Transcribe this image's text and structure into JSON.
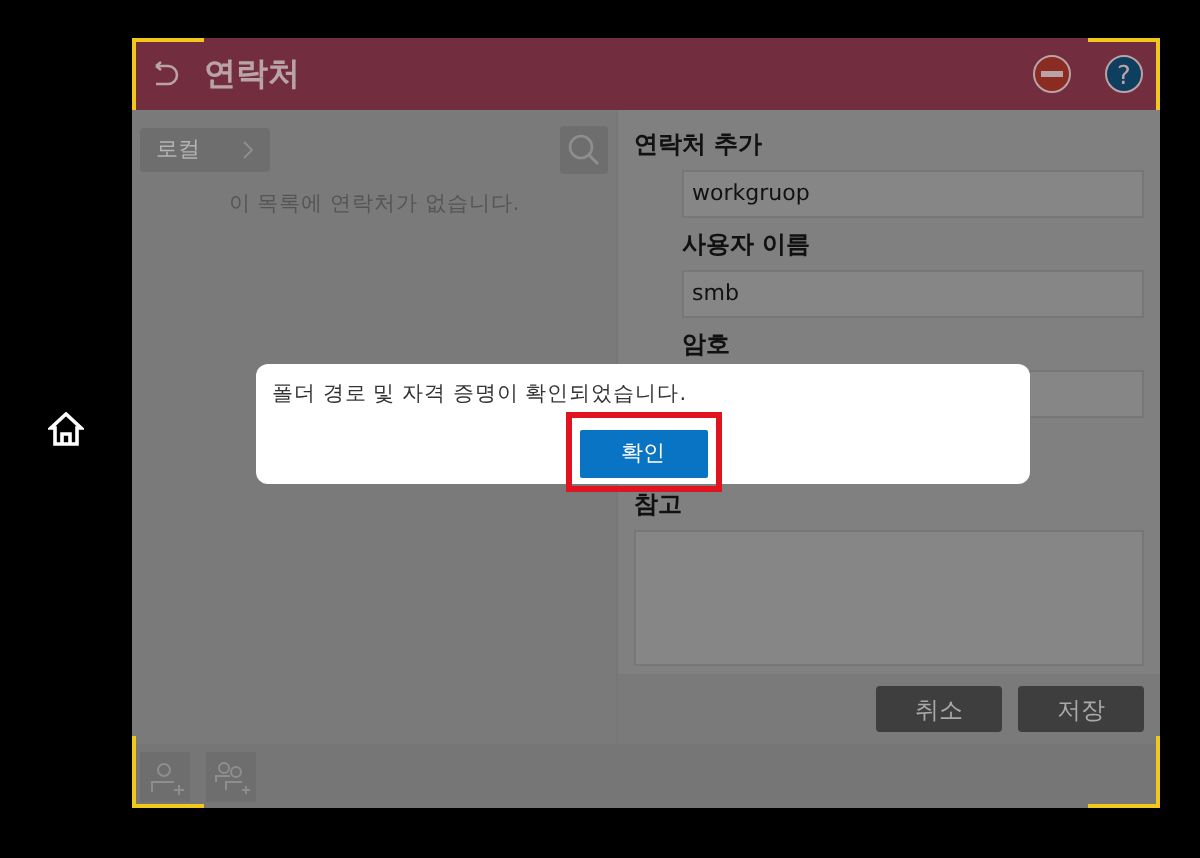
{
  "header": {
    "title": "연락처",
    "help_symbol": "?"
  },
  "contact_list": {
    "source_button": "로컬",
    "empty_message": "이 목록에 연락처가 없습니다."
  },
  "form": {
    "heading": "연락처 추가",
    "fields": [
      {
        "kind": "input",
        "value": "workgruop"
      },
      {
        "kind": "input",
        "label": "사용자 이름",
        "value": "smb"
      },
      {
        "kind": "input",
        "label": "암호"
      },
      {
        "kind": "textarea",
        "label": "참고"
      }
    ],
    "buttons": [
      "취소",
      "저장"
    ]
  },
  "dialog": {
    "message": "폴더 경로 및 자격 증명이 확인되었습니다.",
    "button": "확인",
    "highlighted": true
  }
}
